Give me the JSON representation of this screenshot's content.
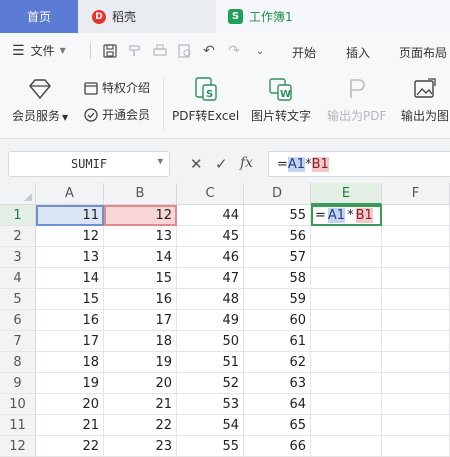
{
  "tabs": [
    {
      "label": "首页"
    },
    {
      "label": "稻壳",
      "icon": "daoke-logo-icon"
    },
    {
      "label": "工作簿1",
      "icon": "spreadsheet-logo-icon"
    }
  ],
  "menubar": {
    "file_label": "文件",
    "menu_tabs": [
      "开始",
      "插入",
      "页面布局"
    ]
  },
  "ribbon": {
    "member_service": "会员服务",
    "privileges": "特权介绍",
    "open_member": "开通会员",
    "pdf_to_excel": "PDF转Excel",
    "image_to_text": "图片转文字",
    "export_pdf": "输出为PDF",
    "export_image": "输出为图"
  },
  "formula_bar": {
    "name_box": "SUMIF",
    "formula_prefix": "=",
    "ref_a": "A1",
    "op": "*",
    "ref_b": "B1",
    "fx_label": "fx"
  },
  "sheet": {
    "columns": [
      "A",
      "B",
      "C",
      "D",
      "E",
      "F"
    ],
    "rows": [
      "1",
      "2",
      "3",
      "4",
      "5",
      "6",
      "7",
      "8",
      "9",
      "10",
      "11",
      "12"
    ],
    "data": [
      [
        "11",
        "12",
        "44",
        "55"
      ],
      [
        "12",
        "13",
        "45",
        "56"
      ],
      [
        "13",
        "14",
        "46",
        "57"
      ],
      [
        "14",
        "15",
        "47",
        "58"
      ],
      [
        "15",
        "16",
        "48",
        "59"
      ],
      [
        "16",
        "17",
        "49",
        "60"
      ],
      [
        "17",
        "18",
        "50",
        "61"
      ],
      [
        "18",
        "19",
        "51",
        "62"
      ],
      [
        "19",
        "20",
        "52",
        "63"
      ],
      [
        "20",
        "21",
        "53",
        "64"
      ],
      [
        "21",
        "22",
        "54",
        "65"
      ],
      [
        "22",
        "23",
        "55",
        "66"
      ]
    ],
    "editing_cell": {
      "prefix": "=",
      "ref_a": "A1",
      "op": "*",
      "ref_b": "B1"
    }
  },
  "colors": {
    "accent": "#5b7bd5",
    "active_green": "#3a9b59",
    "ref_a_highlight": "#c5d3ee",
    "ref_b_highlight": "#f2c9cb"
  }
}
